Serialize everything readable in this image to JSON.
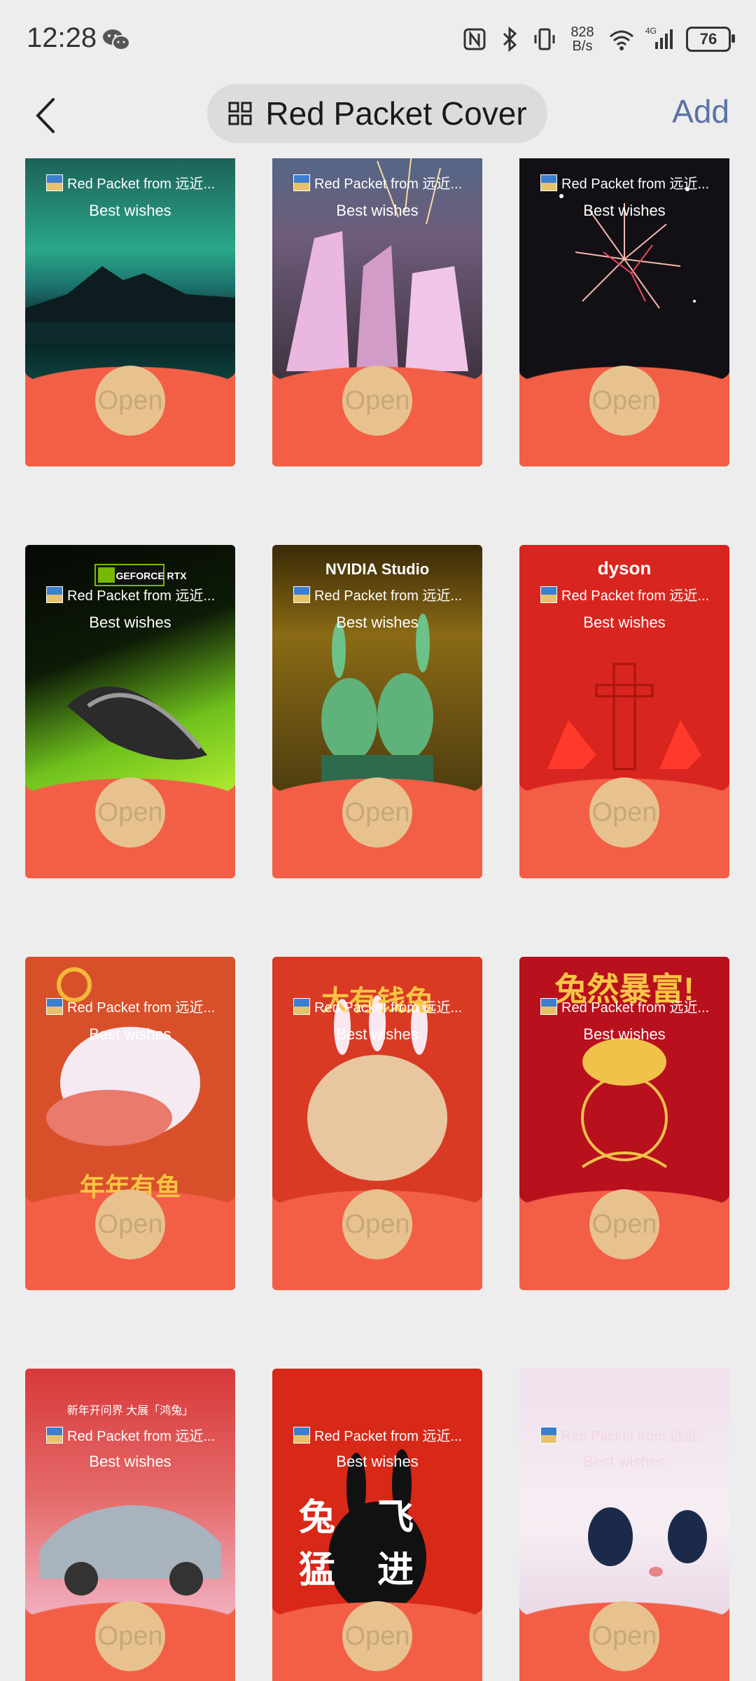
{
  "status": {
    "time": "12:28",
    "net_speed_value": "828",
    "net_speed_unit": "B/s",
    "network": "4G",
    "battery": "76"
  },
  "header": {
    "title": "Red Packet Cover",
    "action": "Add"
  },
  "cards": [
    {
      "from": "Red Packet from 远近...",
      "wish": "Best wishes",
      "open": "Open",
      "brand": ""
    },
    {
      "from": "Red Packet from 远近...",
      "wish": "Best wishes",
      "open": "Open",
      "brand": ""
    },
    {
      "from": "Red Packet from 远近...",
      "wish": "Best wishes",
      "open": "Open",
      "brand": ""
    },
    {
      "from": "Red Packet from 远近...",
      "wish": "Best wishes",
      "open": "Open",
      "brand": "GEFORCE RTX"
    },
    {
      "from": "Red Packet from 远近...",
      "wish": "Best wishes",
      "open": "Open",
      "brand": "NVIDIA Studio"
    },
    {
      "from": "Red Packet from 远近...",
      "wish": "Best wishes",
      "open": "Open",
      "brand": "dyson"
    },
    {
      "from": "Red Packet from 远近...",
      "wish": "Best wishes",
      "open": "Open",
      "brand": "年年有鱼"
    },
    {
      "from": "Red Packet from 远近...",
      "wish": "Best wishes",
      "open": "Open",
      "brand": "大有钱兔"
    },
    {
      "from": "Red Packet from 远近...",
      "wish": "Best wishes",
      "open": "Open",
      "brand": "兔然暴富!"
    },
    {
      "from": "Red Packet from 远近...",
      "wish": "Best wishes",
      "open": "Open",
      "brand": "新年开问界 大展「鸿兔」"
    },
    {
      "from": "Red Packet from 远近...",
      "wish": "Best wishes",
      "open": "Open",
      "brand": "兔飞猛进"
    },
    {
      "from": "Red Packet from 远近...",
      "wish": "Best wishes",
      "open": "Open",
      "brand": ""
    }
  ]
}
